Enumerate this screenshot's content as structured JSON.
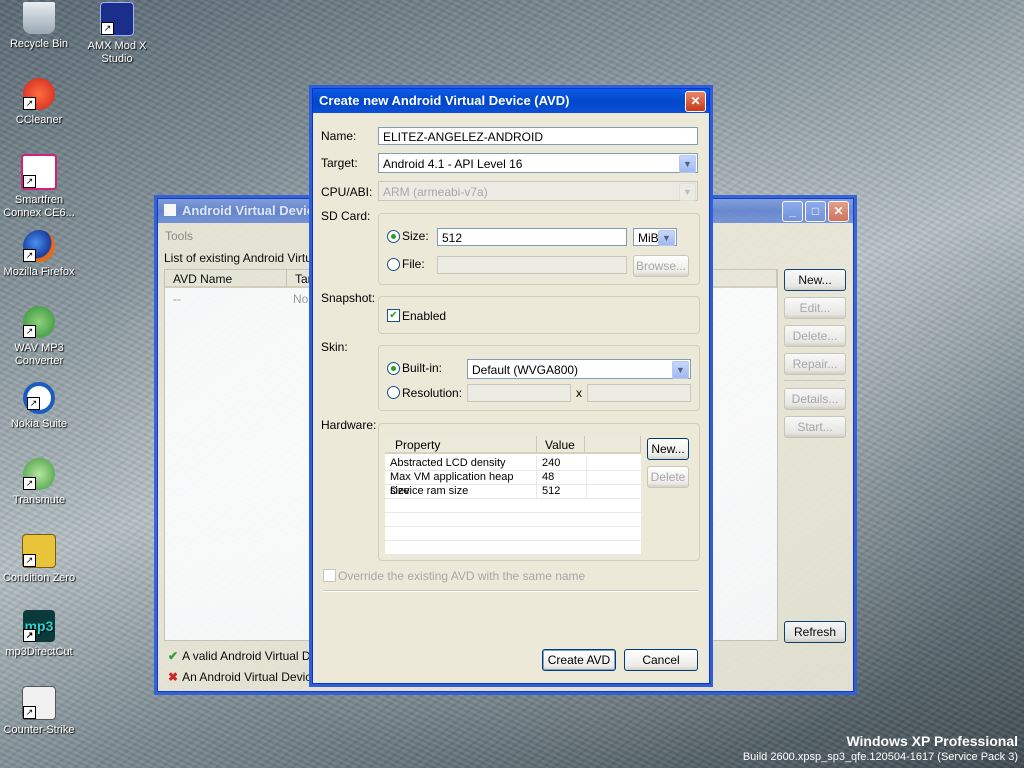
{
  "desktop": {
    "icons": [
      {
        "label": "Recycle Bin"
      },
      {
        "label": "AMX Mod X Studio"
      },
      {
        "label": "CCleaner"
      },
      {
        "label": "Smartfren Connex CE6..."
      },
      {
        "label": "Mozilla Firefox"
      },
      {
        "label": "WAV MP3 Converter"
      },
      {
        "label": "Nokia Suite"
      },
      {
        "label": "Transmute"
      },
      {
        "label": "Condition Zero"
      },
      {
        "label": "mp3DirectCut"
      },
      {
        "label": "Counter-Strike"
      }
    ],
    "os_name": "Windows XP Professional",
    "os_build": "Build 2600.xpsp_sp3_qfe.120504-1617 (Service Pack 3)"
  },
  "avd_manager": {
    "title": "Android Virtual Device",
    "menu_tools": "Tools",
    "list_label": "List of existing Android Virtual D",
    "col_avd_name": "AVD Name",
    "col_target": "Tar",
    "row_name": "--",
    "row_target": "No",
    "buttons": {
      "new": "New...",
      "edit": "Edit...",
      "delete": "Delete...",
      "repair": "Repair...",
      "details": "Details...",
      "start": "Start...",
      "refresh": "Refresh"
    },
    "legend_valid": "A valid Android Virtual Dev",
    "legend_invalid": "An Android Virtual Device",
    "legend_valid_mark": "✔",
    "legend_invalid_mark": "✖"
  },
  "dialog": {
    "title": "Create new Android Virtual Device (AVD)",
    "name_label": "Name:",
    "name_value": "ELITEZ-ANGELEZ-ANDROID",
    "target_label": "Target:",
    "target_value": "Android 4.1 - API Level 16",
    "cpu_label": "CPU/ABI:",
    "cpu_value": "ARM (armeabi-v7a)",
    "sdcard_label": "SD Card:",
    "size_label": "Size:",
    "size_value": "512",
    "size_unit": "MiB",
    "file_label": "File:",
    "browse_label": "Browse...",
    "snapshot_label": "Snapshot:",
    "enabled_label": "Enabled",
    "skin_label": "Skin:",
    "builtin_label": "Built-in:",
    "builtin_value": "Default (WVGA800)",
    "resolution_label": "Resolution:",
    "res_x": "x",
    "hardware_label": "Hardware:",
    "hw_col_property": "Property",
    "hw_col_value": "Value",
    "hw_rows": [
      {
        "property": "Abstracted LCD density",
        "value": "240"
      },
      {
        "property": "Max VM application heap size",
        "value": "48"
      },
      {
        "property": "Device ram size",
        "value": "512"
      }
    ],
    "hw_new": "New...",
    "hw_delete": "Delete",
    "override_label": "Override the existing AVD with the same name",
    "create_button": "Create AVD",
    "cancel_button": "Cancel"
  }
}
